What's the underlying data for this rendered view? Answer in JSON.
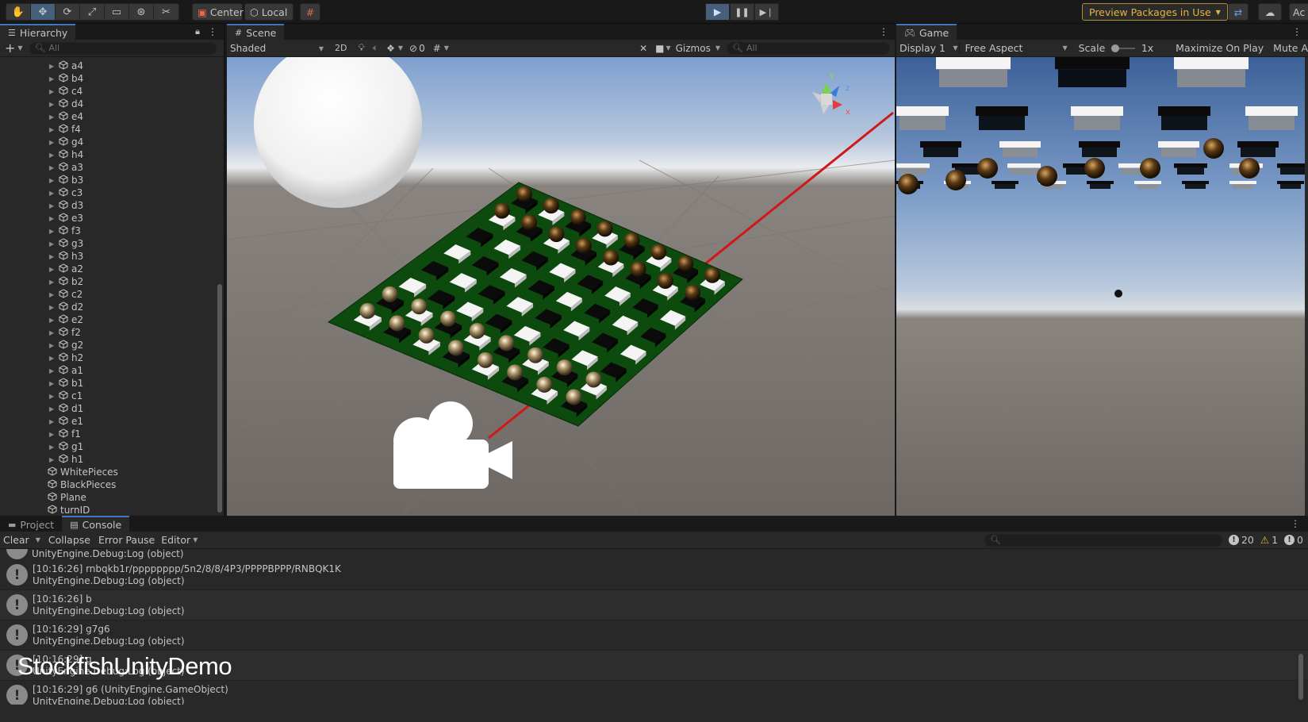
{
  "toolbar": {
    "tools": [
      "hand-tool-icon",
      "move-tool-icon",
      "rotate-tool-icon",
      "scale-tool-icon",
      "rect-tool-icon",
      "transform-tool-icon",
      "custom-tool-icon"
    ],
    "pivot": "Center",
    "space": "Local",
    "preview_packages": "Preview Packages in Use",
    "account": "Ac"
  },
  "hierarchy": {
    "tab": "Hierarchy",
    "search_placeholder": "All",
    "squares": [
      "a4",
      "b4",
      "c4",
      "d4",
      "e4",
      "f4",
      "g4",
      "h4",
      "a3",
      "b3",
      "c3",
      "d3",
      "e3",
      "f3",
      "g3",
      "h3",
      "a2",
      "b2",
      "c2",
      "d2",
      "e2",
      "f2",
      "g2",
      "h2",
      "a1",
      "b1",
      "c1",
      "d1",
      "e1",
      "f1",
      "g1",
      "h1"
    ],
    "objects": [
      "WhitePieces",
      "BlackPieces",
      "Plane",
      "turnID"
    ]
  },
  "scene": {
    "tab": "Scene",
    "shading": "Shaded",
    "mode_2d": "2D",
    "hidden_count": "0",
    "gizmos": "Gizmos",
    "search_placeholder": "All",
    "axis_y": "y",
    "axis_x": "x",
    "axis_z": "z"
  },
  "game": {
    "tab": "Game",
    "display": "Display 1",
    "aspect": "Free Aspect",
    "scale_label": "Scale",
    "scale_value": "1x",
    "maximize": "Maximize On Play",
    "mute": "Mute A"
  },
  "console": {
    "tabs": [
      "Project",
      "Console"
    ],
    "clear": "Clear",
    "collapse": "Collapse",
    "error_pause": "Error Pause",
    "editor": "Editor",
    "log_count": "20",
    "warn_count": "1",
    "error_count": "0",
    "partial_top": "UnityEngine.Debug:Log (object)",
    "entries": [
      {
        "msg": "[10:16:26] rnbqkb1r/pppppppp/5n2/8/8/4P3/PPPPBPPP/RNBQK1K",
        "trace": "UnityEngine.Debug:Log (object)"
      },
      {
        "msg": "[10:16:26] b",
        "trace": "UnityEngine.Debug:Log (object)"
      },
      {
        "msg": "[10:16:29] g7g6",
        "trace": "UnityEngine.Debug:Log (object)"
      },
      {
        "msg": "[10:16:29] g",
        "trace": "UnityEngine.Debug:Log (object)"
      },
      {
        "msg": "[10:16:29] g6 (UnityEngine.GameObject)",
        "trace": "UnityEngine.Debug:Log (object)"
      }
    ]
  },
  "watermark": "StockfishUnityDemo",
  "colors": {
    "accent": "#3a79bb",
    "warning": "#e5b53f",
    "board": "#0d4a0d",
    "ray": "#d01818"
  }
}
